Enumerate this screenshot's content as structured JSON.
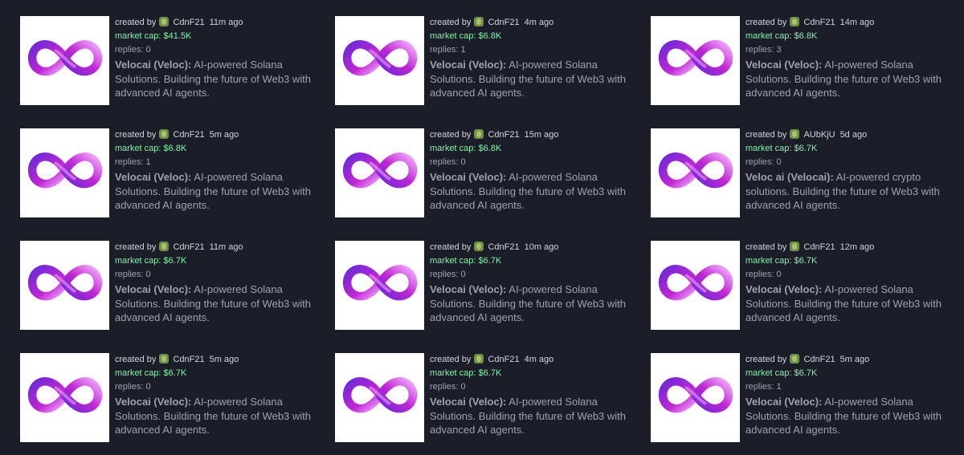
{
  "labels": {
    "created_by": "created by",
    "market_cap_prefix": "market cap: ",
    "replies_prefix": "replies: "
  },
  "icons": {
    "thumbnail": "infinity-logo-icon",
    "avatar": "pepe-avatar-icon"
  },
  "colors": {
    "background": "#1b1d28",
    "market_cap": "#86efac",
    "text": "#9ca3af",
    "logo_gradient": [
      "#6d28d9",
      "#c026d3",
      "#f0abfc"
    ]
  },
  "cards": [
    {
      "creator": "CdnF21",
      "age": "11m ago",
      "market_cap": "$41.5K",
      "replies": "0",
      "name": "Velocai (Veloc):",
      "description": " AI-powered Solana Solutions. Building the future of Web3 with advanced AI agents."
    },
    {
      "creator": "CdnF21",
      "age": "4m ago",
      "market_cap": "$6.8K",
      "replies": "1",
      "name": "Velocai (Veloc):",
      "description": " AI-powered Solana Solutions. Building the future of Web3 with advanced AI agents."
    },
    {
      "creator": "CdnF21",
      "age": "14m ago",
      "market_cap": "$6.8K",
      "replies": "3",
      "name": "Velocai (Veloc):",
      "description": " AI-powered Solana Solutions. Building the future of Web3 with advanced AI agents."
    },
    {
      "creator": "CdnF21",
      "age": "5m ago",
      "market_cap": "$6.8K",
      "replies": "1",
      "name": "Velocai (Veloc):",
      "description": " AI-powered Solana Solutions. Building the future of Web3 with advanced AI agents."
    },
    {
      "creator": "CdnF21",
      "age": "15m ago",
      "market_cap": "$6.8K",
      "replies": "0",
      "name": "Velocai (Veloc):",
      "description": " AI-powered Solana Solutions. Building the future of Web3 with advanced AI agents."
    },
    {
      "creator": "AUbKjU",
      "age": "5d ago",
      "market_cap": "$6.7K",
      "replies": "0",
      "name": "Veloc ai (Velocai):",
      "description": " AI-powered crypto solutions. Building the future of Web3 with advanced AI agents."
    },
    {
      "creator": "CdnF21",
      "age": "11m ago",
      "market_cap": "$6.7K",
      "replies": "0",
      "name": "Velocai (Veloc):",
      "description": " AI-powered Solana Solutions. Building the future of Web3 with advanced AI agents."
    },
    {
      "creator": "CdnF21",
      "age": "10m ago",
      "market_cap": "$6.7K",
      "replies": "0",
      "name": "Velocai (Veloc):",
      "description": " AI-powered Solana Solutions. Building the future of Web3 with advanced AI agents."
    },
    {
      "creator": "CdnF21",
      "age": "12m ago",
      "market_cap": "$6.7K",
      "replies": "0",
      "name": "Velocai (Veloc):",
      "description": " AI-powered Solana Solutions. Building the future of Web3 with advanced AI agents."
    },
    {
      "creator": "CdnF21",
      "age": "5m ago",
      "market_cap": "$6.7K",
      "replies": "0",
      "name": "Velocai (Veloc):",
      "description": " AI-powered Solana Solutions. Building the future of Web3 with advanced AI agents."
    },
    {
      "creator": "CdnF21",
      "age": "4m ago",
      "market_cap": "$6.7K",
      "replies": "0",
      "name": "Velocai (Veloc):",
      "description": " AI-powered Solana Solutions. Building the future of Web3 with advanced AI agents."
    },
    {
      "creator": "CdnF21",
      "age": "5m ago",
      "market_cap": "$6.7K",
      "replies": "1",
      "name": "Velocai (Veloc):",
      "description": " AI-powered Solana Solutions. Building the future of Web3 with advanced AI agents."
    }
  ]
}
